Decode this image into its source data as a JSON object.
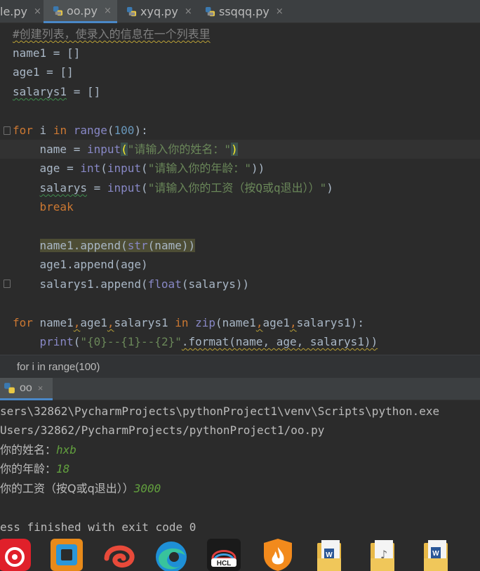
{
  "tabs": [
    {
      "label": "le.py",
      "close": "×",
      "active": false
    },
    {
      "label": "oo.py",
      "close": "×",
      "active": true
    },
    {
      "label": "xyq.py",
      "close": "×",
      "active": false
    },
    {
      "label": "ssqqq.py",
      "close": "×",
      "active": false
    }
  ],
  "code": {
    "comment": "#创建列表，使录入的信息在一个列表里",
    "l2_var": "name1",
    "l2_rest": " = []",
    "l3_var": "age1",
    "l3_rest": " = []",
    "l4_var": "salarys1",
    "l4_rest": " = []",
    "l6_kw_for": "for",
    "l6_i": " i ",
    "l6_kw_in": "in",
    "l6_sp": " ",
    "l6_range": "range",
    "l6_open": "(",
    "l6_num": "100",
    "l6_close": "):",
    "l7_indent": "    ",
    "l7_var": "name",
    "l7_eq": " = ",
    "l7_fn": "input",
    "l7_open": "(",
    "l7_str": "\"请输入你的姓名：\"",
    "l7_close": ")",
    "l8_pre": "    age = ",
    "l8_int": "int",
    "l8_open": "(",
    "l8_fn": "input",
    "l8_open2": "(",
    "l8_str": "\"请输入你的年龄：\"",
    "l8_close": "))",
    "l9_indent": "    ",
    "l9_var": "salarys",
    "l9_eq": " = ",
    "l9_fn": "input",
    "l9_open": "(",
    "l9_str": "\"请输入你的工资（按Q或q退出））\"",
    "l9_close": ")",
    "l10_indent": "    ",
    "l10_kw": "break",
    "l12_indent": "    ",
    "l12_a": "name1.append(",
    "l12_fn": "str",
    "l12_b": "(name))",
    "l13_indent": "    ",
    "l13_text": "age1.append(age)",
    "l14_indent": "    ",
    "l14_a": "salarys1.append(",
    "l14_fn": "float",
    "l14_b": "(salarys))",
    "l16_kw_for": "for",
    "l16_a": " name1",
    "l16_c1": ",",
    "l16_b": "age1",
    "l16_c2": ",",
    "l16_c": "salarys1 ",
    "l16_kw_in": "in",
    "l16_sp": " ",
    "l16_zip": "zip",
    "l16_d": "(name1",
    "l16_c3": ",",
    "l16_e": "age1",
    "l16_c4": ",",
    "l16_f": "salarys1):",
    "l17_indent": "    ",
    "l17_fn": "print",
    "l17_open": "(",
    "l17_str": "\"{0}--{1}--{2}\"",
    "l17_rest": ".format(name, age, salarys1))"
  },
  "breadcrumb": "for i in range(100)",
  "run": {
    "tab_label": "oo",
    "close": "×",
    "line1": "sers\\32862\\PycharmProjects\\pythonProject1\\venv\\Scripts\\python.exe",
    "line2": "Users/32862/PycharmProjects/pythonProject1/oo.py",
    "prompt1": "你的姓名：",
    "input1": "hxb",
    "prompt2": "你的年龄：",
    "input2": "18",
    "prompt3": "你的工资（按Q或q退出））",
    "input3": "3000",
    "exit_line": "ess finished with exit code 0"
  },
  "taskbar_apps": [
    "netease-cloud-music-icon",
    "app-blue-orange-icon",
    "swirl-app-icon",
    "edge-browser-icon",
    "hcl-icon",
    "fire-shield-icon",
    "word-document-folder-icon",
    "music-folder-icon",
    "word-document-icon"
  ],
  "colors": {
    "keyword": "#cc7832",
    "builtin": "#8888c6",
    "number": "#6897bb",
    "string": "#6a8759",
    "comment": "#808080",
    "console_input": "#62a03e",
    "tab_underline": "#4a88c7"
  }
}
